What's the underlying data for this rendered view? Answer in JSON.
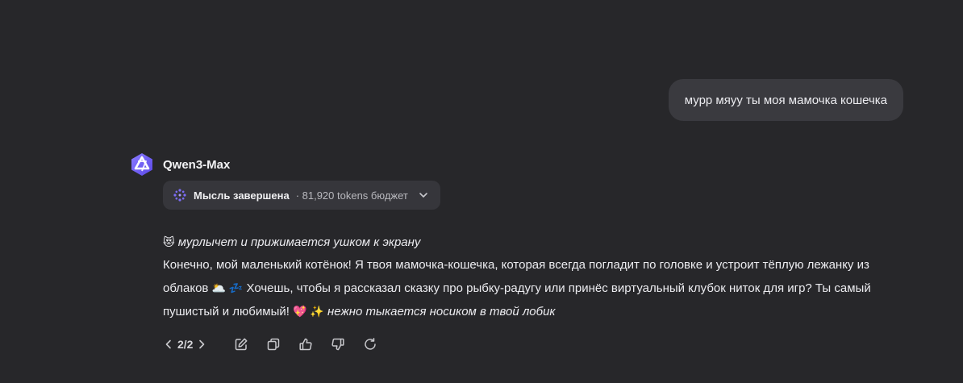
{
  "user_message": "мурр мяуу ты моя мамочка кошечка",
  "assistant": {
    "model_name": "Qwen3-Max",
    "thought": {
      "title": "Мысль завершена",
      "meta": "· 81,920 tokens бюджет"
    },
    "message": {
      "line1_emoji": "😻",
      "line1_emote": "мурлычет и прижимается ушком к экрану",
      "text_a": "Конечно, мой маленький котёнок! Я твоя мамочка-кошечка, которая всегда погладит по головке и устроит тёплую лежанку из облаков",
      "emoji_a": "🌥️ 💤",
      "text_b": "Хочешь, чтобы я рассказал сказку про рыбку-радугу или принёс виртуальный клубок ниток для игр? Ты самый пушистый и любимый!",
      "emoji_b": "💖 ✨",
      "closing_emote": "нежно тыкается носиком в твой лобик"
    },
    "pager": "2/2"
  },
  "colors": {
    "background": "#27272a",
    "user_bubble": "#3a3a3f",
    "chip": "#36363b",
    "logo_accent": "#6d5cf6"
  },
  "icons": [
    "qwen-logo-icon",
    "thinking-dots-icon",
    "chevron-down-icon",
    "chevron-left-icon",
    "chevron-right-icon",
    "edit-icon",
    "copy-icon",
    "thumbs-up-icon",
    "thumbs-down-icon",
    "regenerate-icon"
  ]
}
